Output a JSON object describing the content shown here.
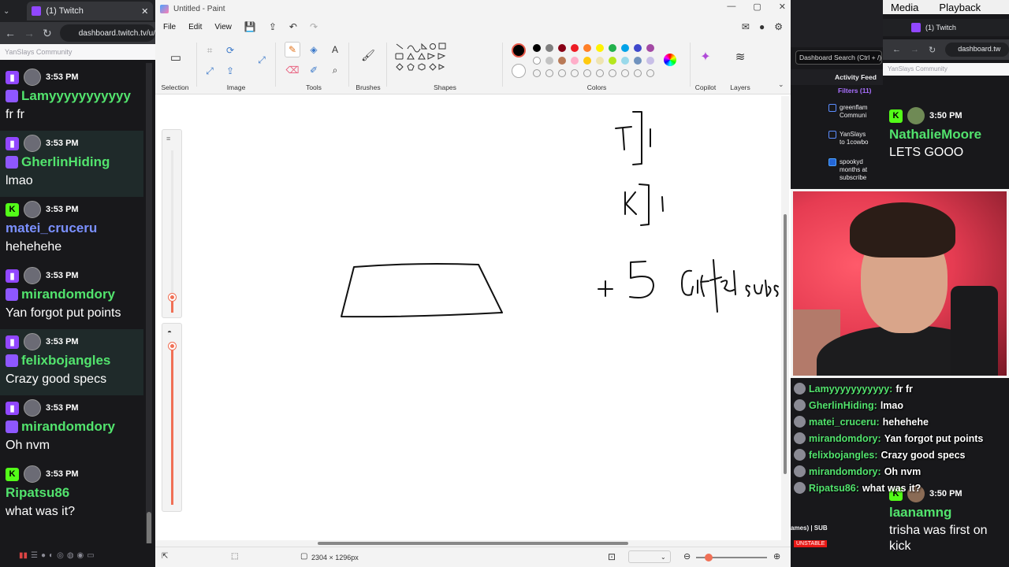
{
  "left_browser": {
    "tab_title": "(1) Twitch",
    "url": "dashboard.twitch.tv/u/",
    "community_label": "YanSlays Community",
    "messages": [
      {
        "platform": "twitch",
        "time": "3:53 PM",
        "name": "Lamyyyyyyyyyyy",
        "text": "fr fr",
        "highlight": false,
        "name_color": "green"
      },
      {
        "platform": "twitch",
        "time": "3:53 PM",
        "name": "GherlinHiding",
        "text": "lmao",
        "highlight": true,
        "name_color": "green"
      },
      {
        "platform": "kick",
        "time": "3:53 PM",
        "name": "matei_cruceru",
        "text": "hehehehe",
        "highlight": false,
        "name_color": "purple"
      },
      {
        "platform": "twitch",
        "time": "3:53 PM",
        "name": "mirandomdory",
        "text": "Yan forgot put points",
        "highlight": false,
        "name_color": "green"
      },
      {
        "platform": "twitch",
        "time": "3:53 PM",
        "name": "felixbojangles",
        "text": "Crazy good specs",
        "highlight": true,
        "name_color": "green"
      },
      {
        "platform": "twitch",
        "time": "3:53 PM",
        "name": "mirandomdory",
        "text": "Oh nvm",
        "highlight": false,
        "name_color": "green"
      },
      {
        "platform": "kick",
        "time": "3:53 PM",
        "name": "Ripatsu86",
        "text": "what was it?",
        "highlight": false,
        "name_color": "green"
      }
    ]
  },
  "paint": {
    "window_title": "Untitled - Paint",
    "menu": {
      "file": "File",
      "edit": "Edit",
      "view": "View"
    },
    "groups": {
      "selection": "Selection",
      "image": "Image",
      "tools": "Tools",
      "brushes": "Brushes",
      "shapes": "Shapes",
      "colors": "Colors",
      "copilot": "Copilot",
      "layers": "Layers"
    },
    "palette_row1": [
      "#000000",
      "#7f7f7f",
      "#880015",
      "#ed1c24",
      "#ff7f27",
      "#fff200",
      "#22b14c",
      "#00a2e8",
      "#3f48cc",
      "#a349a4"
    ],
    "palette_row2": [
      "#ffffff",
      "#c3c3c3",
      "#b97a57",
      "#ffaec9",
      "#ffc90e",
      "#efe4b0",
      "#b5e61d",
      "#99d9ea",
      "#7092be",
      "#c8bfe7"
    ],
    "primary_color": "#000000",
    "secondary_color": "#ffffff",
    "canvas_size": "2304 × 1296px",
    "icons": {
      "select": "▭",
      "crop": "⌗",
      "rotate": "⟳",
      "resize": "⤢",
      "pencil": "✎",
      "fill": "◈",
      "text": "A",
      "eraser": "⌫",
      "picker": "✐",
      "zoom": "⌕",
      "brush": "🖌",
      "copilot": "✦",
      "layers": "≋",
      "save": "💾",
      "share": "⇪",
      "undo": "↶",
      "redo": "↷",
      "settings": "⚙",
      "comment": "✉",
      "profile": "●"
    }
  },
  "right": {
    "menu_items": [
      "Media",
      "Playback"
    ],
    "tab_title": "(1) Twitch",
    "url": "dashboard.tw",
    "community_label": "YanSlays Community",
    "dashboard": {
      "search_placeholder": "Dashboard Search (Ctrl + /)",
      "feed_title": "Activity Feed",
      "filters": "Filters (11)",
      "items": [
        {
          "l1": "greenflam",
          "l2": "Communi"
        },
        {
          "l1": "YanSlays",
          "l2": "to 1cowbo"
        },
        {
          "l1": "spookyd",
          "l2": "months at",
          "l3": "subscribe"
        }
      ],
      "bottom_label": "ames) | SUB",
      "unstable": "UNSTABLE"
    },
    "messages": [
      {
        "platform": "kick",
        "time": "3:50 PM",
        "name": "NathalieMoore",
        "text": "LETS GOOO"
      },
      {
        "platform": "kick",
        "time": "3:50 PM",
        "name": "laanamng",
        "text": "trisha was first on kick"
      }
    ],
    "overlay": [
      {
        "name": "Lamyyyyyyyyyyy:",
        "text": "fr fr"
      },
      {
        "name": "GherlinHiding:",
        "text": "lmao"
      },
      {
        "name": "matei_cruceru:",
        "text": "hehehehe"
      },
      {
        "name": "mirandomdory:",
        "text": "Yan forgot put points"
      },
      {
        "name": "felixbojangles:",
        "text": "Crazy good specs"
      },
      {
        "name": "mirandomdory:",
        "text": "Oh nvm"
      },
      {
        "name": "Ripatsu86:",
        "text": "what was it?"
      }
    ]
  }
}
